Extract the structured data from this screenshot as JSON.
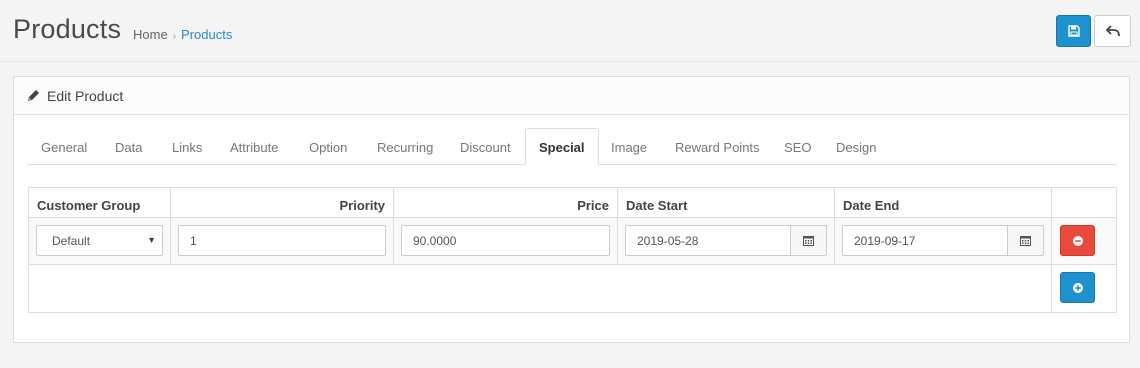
{
  "header": {
    "title": "Products",
    "breadcrumb": {
      "home": "Home",
      "separator": "›",
      "current": "Products"
    },
    "save_icon": "floppy-disk-icon",
    "back_icon": "reply-arrow-icon"
  },
  "panel": {
    "title": "Edit Product",
    "icon": "pencil-icon"
  },
  "tabs": [
    "General",
    "Data",
    "Links",
    "Attribute",
    "Option",
    "Recurring",
    "Discount",
    "Special",
    "Image",
    "Reward Points",
    "SEO",
    "Design"
  ],
  "active_tab": "Special",
  "special_table": {
    "columns": [
      "Customer Group",
      "Priority",
      "Price",
      "Date Start",
      "Date End"
    ],
    "rows": [
      {
        "customer_group": "Default",
        "priority": "1",
        "price": "90.0000",
        "date_start": "2019-05-28",
        "date_end": "2019-09-17"
      }
    ]
  },
  "colors": {
    "primary": "#1e91cf",
    "danger": "#e84b3c",
    "link": "#2a8ac4"
  }
}
